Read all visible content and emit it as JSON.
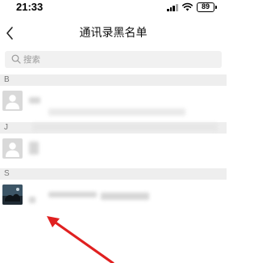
{
  "status_bar": {
    "time": "21:33",
    "battery": "89",
    "icons": [
      "signal-icon",
      "wifi-icon",
      "battery-icon"
    ]
  },
  "nav": {
    "title": "通讯录黑名单",
    "back_icon": "chevron-left-icon"
  },
  "search": {
    "placeholder": "搜索",
    "value": "",
    "icon": "search-icon"
  },
  "sections": [
    {
      "letter": "B",
      "contacts": [
        {
          "name": ""
        }
      ]
    },
    {
      "letter": "J",
      "contacts": [
        {
          "name": ""
        }
      ]
    },
    {
      "letter": "S",
      "contacts": [
        {
          "name": ""
        }
      ]
    }
  ],
  "annotation": {
    "arrow_color": "#e02020"
  }
}
